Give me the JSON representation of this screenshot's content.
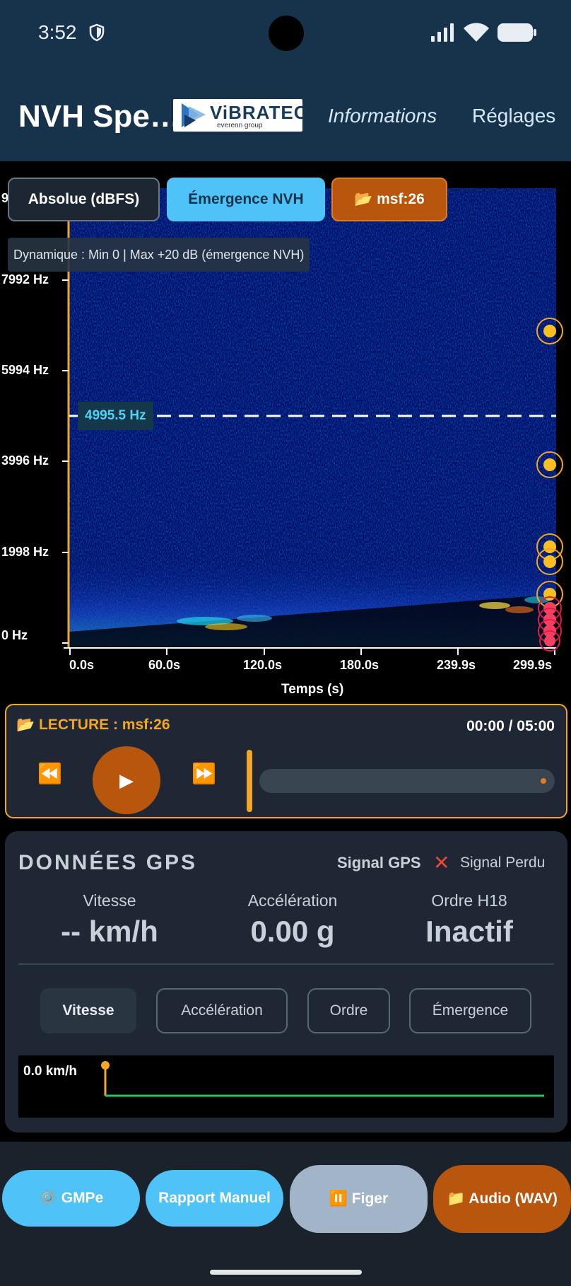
{
  "status_bar": {
    "time": "3:52"
  },
  "app_bar": {
    "title": "NVH Spe…",
    "logo_text": "ViBRATEC",
    "logo_sub": "everenn group",
    "nav_info": "Informations",
    "nav_settings": "Réglages"
  },
  "spectrogram": {
    "mode_buttons": {
      "absolute": "Absolue (dBFS)",
      "emergence": "Émergence NVH",
      "file": "📂 msf:26"
    },
    "dynamic_text": "Dynamique : Min 0 | Max +20 dB (émergence NVH)",
    "y_ticks": [
      "7992 Hz",
      "5994 Hz",
      "3996 Hz",
      "1998 Hz",
      "0 Hz"
    ],
    "y_partial_top": "999",
    "x_ticks": [
      "0.0s",
      "60.0s",
      "120.0s",
      "180.0s",
      "239.9s",
      "299.9s"
    ],
    "x_title": "Temps (s)",
    "cursor_label": "4995.5 Hz"
  },
  "playback": {
    "title": "📂 LECTURE : msf:26",
    "time": "00:00 / 05:00",
    "rewind": "⏪",
    "play": "▶",
    "forward": "⏩"
  },
  "gps": {
    "title": "DONNÉES GPS",
    "signal_label": "Signal GPS",
    "signal_icon": "✕",
    "signal_status": "Signal Perdu",
    "speed_label": "Vitesse",
    "speed_value": "-- km/h",
    "accel_label": "Accélération",
    "accel_value": "0.00 g",
    "order_label": "Ordre H18",
    "order_value": "Inactif",
    "chips": [
      "Vitesse",
      "Accélération",
      "Ordre",
      "Émergence"
    ],
    "mini_chart_label": "0.0 km/h"
  },
  "bottom_bar": {
    "gmp": "⚙️ GMPe",
    "report": "Rapport Manuel",
    "freeze": "⏸️ Figer",
    "audio": "📁 Audio (WAV)"
  },
  "colors": {
    "header_bg": "#17334b",
    "accent_blue": "#4fc3f7",
    "accent_orange": "#f5a524",
    "button_orange": "#b8560e",
    "card_bg": "#1e2733"
  }
}
